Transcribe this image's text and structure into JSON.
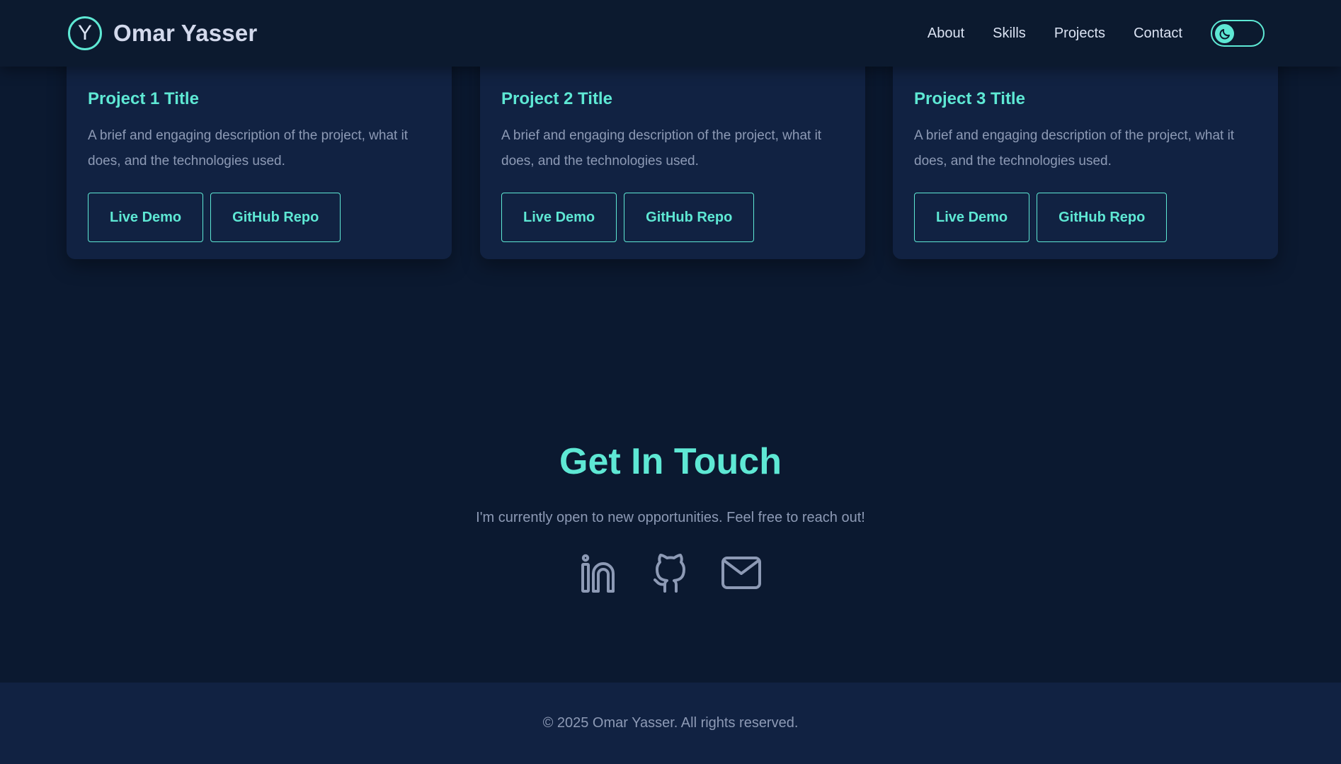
{
  "header": {
    "logo_letter": "Y",
    "name": "Omar Yasser",
    "nav": [
      {
        "label": "About"
      },
      {
        "label": "Skills"
      },
      {
        "label": "Projects"
      },
      {
        "label": "Contact"
      }
    ],
    "theme_toggle_icon": "moon-icon"
  },
  "projects": [
    {
      "title": "Project 1 Title",
      "description": "A brief and engaging description of the project, what it does, and the technologies used.",
      "demo_label": "Live Demo",
      "repo_label": "GitHub Repo"
    },
    {
      "title": "Project 2 Title",
      "description": "A brief and engaging description of the project, what it does, and the technologies used.",
      "demo_label": "Live Demo",
      "repo_label": "GitHub Repo"
    },
    {
      "title": "Project 3 Title",
      "description": "A brief and engaging description of the project, what it does, and the technologies used.",
      "demo_label": "Live Demo",
      "repo_label": "GitHub Repo"
    }
  ],
  "contact": {
    "title": "Get In Touch",
    "text": "I'm currently open to new opportunities. Feel free to reach out!",
    "socials": [
      {
        "icon": "linkedin-icon"
      },
      {
        "icon": "github-icon"
      },
      {
        "icon": "mail-icon"
      }
    ]
  },
  "footer": {
    "text": "© 2025 Omar Yasser. All rights reserved."
  },
  "colors": {
    "background": "#0b1930",
    "card": "#112242",
    "accent": "#5ee8d4",
    "text_muted": "#8d9ab5",
    "text_light": "#dbe3f3"
  }
}
